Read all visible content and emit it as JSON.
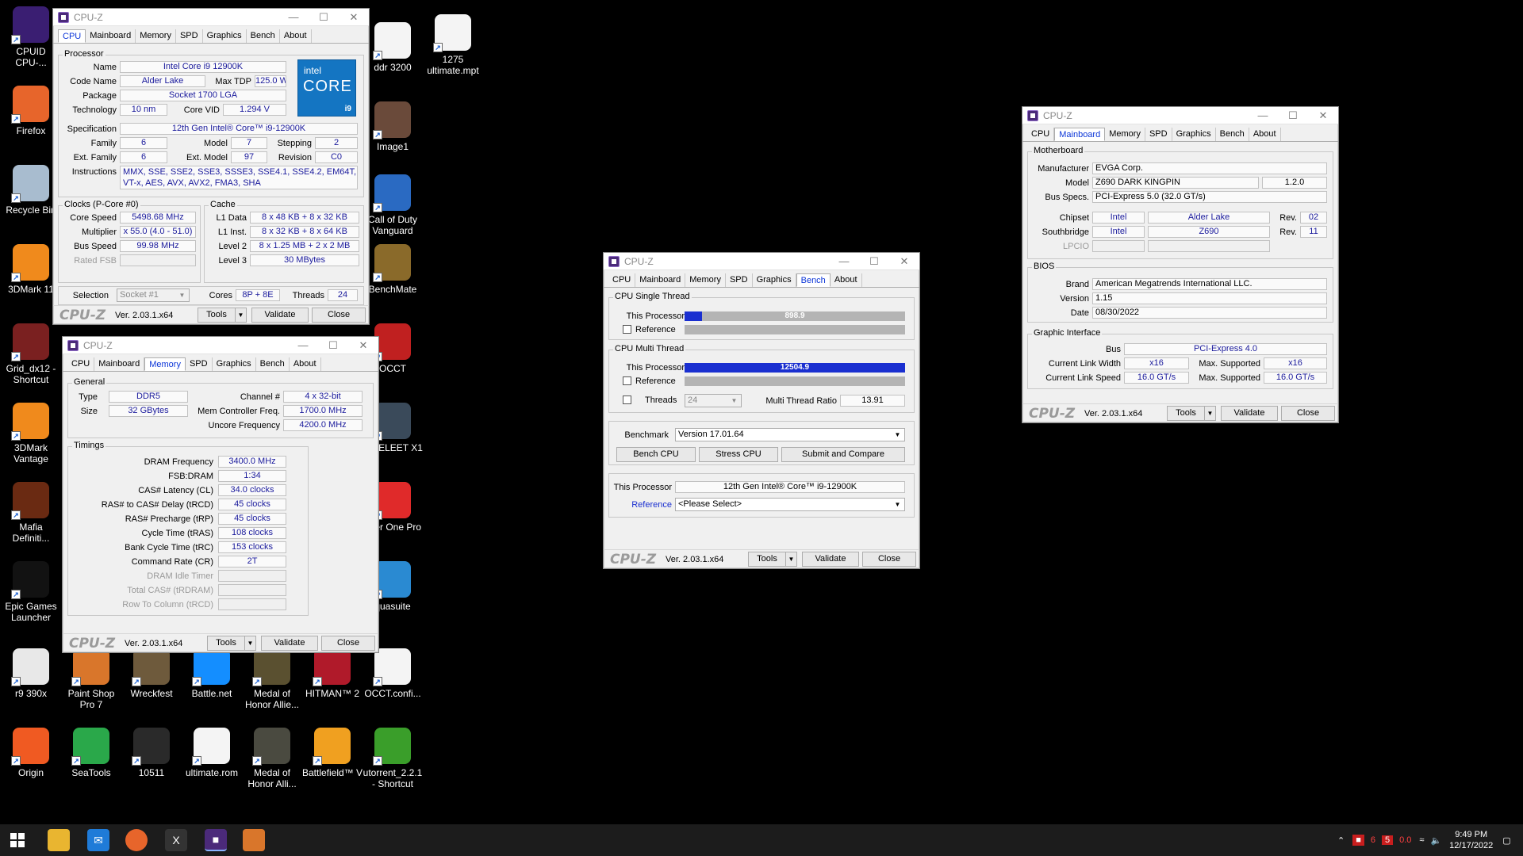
{
  "desktop": {
    "icons": [
      {
        "label": "CPUID CPU-...",
        "icon": "cpuz-icon",
        "color": "#3a1e72"
      },
      {
        "label": "Firefox",
        "icon": "firefox-icon",
        "color": "#e7652b"
      },
      {
        "label": "Recycle Bin",
        "icon": "recycle-bin-icon",
        "color": "#a8bccf"
      },
      {
        "label": "3DMark 11",
        "icon": "3dmark-icon",
        "color": "#f08a1c"
      },
      {
        "label": "Grid_dx12 - Shortcut",
        "icon": "grid-game-icon",
        "color": "#7a2020"
      },
      {
        "label": "3DMark Vantage",
        "icon": "3dmark-vantage-icon",
        "color": "#f08a1c"
      },
      {
        "label": "Mafia Definiti...",
        "icon": "mafia-icon",
        "color": "#6a2a12"
      },
      {
        "label": "Epic Games Launcher",
        "icon": "epic-games-icon",
        "color": "#121212"
      },
      {
        "label": "r9 390x",
        "icon": "file-icon",
        "color": "#e8e8e8"
      },
      {
        "label": "Paint Shop Pro 7",
        "icon": "paint-shop-icon",
        "color": "#d9762b"
      },
      {
        "label": "Wreckfest",
        "icon": "wreckfest-icon",
        "color": "#6e5a3c"
      },
      {
        "label": "Battle.net",
        "icon": "battlenet-icon",
        "color": "#148eff"
      },
      {
        "label": "Medal of Honor Allie...",
        "icon": "medal-of-honor-icon",
        "color": "#5a5030"
      },
      {
        "label": "HITMAN™ 2",
        "icon": "hitman-icon",
        "color": "#b01a2a"
      },
      {
        "label": "OCCT.confi...",
        "icon": "document-icon",
        "color": "#f4f4f4"
      },
      {
        "label": "Origin",
        "icon": "origin-icon",
        "color": "#f05a22"
      },
      {
        "label": "SeaTools",
        "icon": "seatools-icon",
        "color": "#2aa84a"
      },
      {
        "label": "10511",
        "icon": "image-icon",
        "color": "#2a2a2a"
      },
      {
        "label": "ultimate.rom",
        "icon": "document-icon",
        "color": "#f4f4f4"
      },
      {
        "label": "Medal of Honor Alli...",
        "icon": "medal-of-honor-icon",
        "color": "#4a4a40"
      },
      {
        "label": "Battlefield™ V",
        "icon": "battlefield-icon",
        "color": "#f0a020"
      },
      {
        "label": "utorrent_2.2.1 - Shortcut",
        "icon": "utorrent-icon",
        "color": "#3a9e2a"
      },
      {
        "label": "ddr 3200",
        "icon": "document-icon",
        "color": "#f4f4f4"
      },
      {
        "label": "1275 ultimate.mpt",
        "icon": "document-icon",
        "color": "#f4f4f4"
      },
      {
        "label": "Image1",
        "icon": "image-icon",
        "color": "#6a4a3a"
      },
      {
        "label": "Call of Duty Vanguard",
        "icon": "call-of-duty-icon",
        "color": "#2a6ac2"
      },
      {
        "label": "BenchMate",
        "icon": "benchmate-icon",
        "color": "#8a6a2a"
      },
      {
        "label": "OCCT",
        "icon": "occt-icon",
        "color": "#c02020"
      },
      {
        "label": "GA ELEET X1",
        "icon": "eleet-icon",
        "color": "#3a4a5a"
      },
      {
        "label": "aner One Pro",
        "icon": "cleaner-icon",
        "color": "#e02a2a"
      },
      {
        "label": "quasuite",
        "icon": "aquasuite-icon",
        "color": "#2a8ad2"
      }
    ]
  },
  "common": {
    "window_title": "CPU-Z",
    "tabs": [
      "CPU",
      "Mainboard",
      "Memory",
      "SPD",
      "Graphics",
      "Bench",
      "About"
    ],
    "logo": "CPU-Z",
    "version": "Ver. 2.03.1.x64",
    "tools": "Tools",
    "validate": "Validate",
    "close": "Close"
  },
  "cpu_tab": {
    "processor_group": "Processor",
    "name_label": "Name",
    "name": "Intel Core i9 12900K",
    "codename_label": "Code Name",
    "codename": "Alder Lake",
    "maxtdp_label": "Max TDP",
    "maxtdp": "125.0 W",
    "package_label": "Package",
    "package": "Socket 1700 LGA",
    "technology_label": "Technology",
    "technology": "10 nm",
    "corevid_label": "Core VID",
    "corevid": "1.294 V",
    "spec_label": "Specification",
    "spec": "12th Gen Intel® Core™ i9-12900K",
    "family_label": "Family",
    "family": "6",
    "model_label": "Model",
    "model": "7",
    "stepping_label": "Stepping",
    "stepping": "2",
    "extfamily_label": "Ext. Family",
    "extfamily": "6",
    "extmodel_label": "Ext. Model",
    "extmodel": "97",
    "revision_label": "Revision",
    "revision": "C0",
    "instructions_label": "Instructions",
    "instructions": "MMX, SSE, SSE2, SSE3, SSSE3, SSE4.1, SSE4.2, EM64T, VT-x, AES, AVX, AVX2, FMA3, SHA",
    "clocks_group": "Clocks (P-Core #0)",
    "corespeed_label": "Core Speed",
    "corespeed": "5498.68 MHz",
    "multiplier_label": "Multiplier",
    "multiplier": "x 55.0 (4.0 - 51.0)",
    "busspeed_label": "Bus Speed",
    "busspeed": "99.98 MHz",
    "ratedfsb_label": "Rated FSB",
    "cache_group": "Cache",
    "l1data_label": "L1 Data",
    "l1data": "8 x 48 KB + 8 x 32 KB",
    "l1inst_label": "L1 Inst.",
    "l1inst": "8 x 32 KB + 8 x 64 KB",
    "l2_label": "Level 2",
    "l2": "8 x 1.25 MB + 2 x 2 MB",
    "l3_label": "Level 3",
    "l3": "30 MBytes",
    "selection_label": "Selection",
    "selection": "Socket #1",
    "cores_label": "Cores",
    "cores": "8P + 8E",
    "threads_label": "Threads",
    "threads": "24",
    "intel_logo": {
      "brand": "intel",
      "line": "CORE",
      "tier": "i9"
    }
  },
  "memory_tab": {
    "general_group": "General",
    "type_label": "Type",
    "type": "DDR5",
    "size_label": "Size",
    "size": "32 GBytes",
    "channel_label": "Channel #",
    "channel": "4 x 32-bit",
    "memctrl_label": "Mem Controller Freq.",
    "memctrl": "1700.0 MHz",
    "uncore_label": "Uncore Frequency",
    "uncore": "4200.0 MHz",
    "timings_group": "Timings",
    "timings": [
      {
        "label": "DRAM Frequency",
        "value": "3400.0 MHz"
      },
      {
        "label": "FSB:DRAM",
        "value": "1:34"
      },
      {
        "label": "CAS# Latency (CL)",
        "value": "34.0 clocks"
      },
      {
        "label": "RAS# to CAS# Delay (tRCD)",
        "value": "45 clocks"
      },
      {
        "label": "RAS# Precharge (tRP)",
        "value": "45 clocks"
      },
      {
        "label": "Cycle Time (tRAS)",
        "value": "108 clocks"
      },
      {
        "label": "Bank Cycle Time (tRC)",
        "value": "153 clocks"
      },
      {
        "label": "Command Rate (CR)",
        "value": "2T"
      }
    ],
    "disabled_timings": [
      "DRAM Idle Timer",
      "Total CAS# (tRDRAM)",
      "Row To Column (tRCD)"
    ]
  },
  "bench_tab": {
    "single_group": "CPU Single Thread",
    "multi_group": "CPU Multi Thread",
    "this_processor_label": "This Processor",
    "reference_label": "Reference",
    "single_score": "898.9",
    "single_fraction": 0.08,
    "multi_score": "12504.9",
    "multi_fraction": 1.0,
    "threads_label": "Threads",
    "threads": "24",
    "ratio_label": "Multi Thread Ratio",
    "ratio": "13.91",
    "benchmark_label": "Benchmark",
    "benchmark": "Version 17.01.64",
    "bench_cpu": "Bench CPU",
    "stress_cpu": "Stress CPU",
    "submit": "Submit and Compare",
    "this_processor_name": "12th Gen Intel® Core™ i9-12900K",
    "reference_link": "Reference",
    "reference_select": "<Please Select>"
  },
  "mainboard_tab": {
    "motherboard_group": "Motherboard",
    "manufacturer_label": "Manufacturer",
    "manufacturer": "EVGA Corp.",
    "model_label": "Model",
    "model": "Z690 DARK KINGPIN",
    "model_rev": "1.2.0",
    "busspecs_label": "Bus Specs.",
    "busspecs": "PCI-Express 5.0 (32.0 GT/s)",
    "chipset_label": "Chipset",
    "chipset_vendor": "Intel",
    "chipset_name": "Alder Lake",
    "rev_label": "Rev.",
    "chipset_rev": "02",
    "southbridge_label": "Southbridge",
    "sb_vendor": "Intel",
    "sb_name": "Z690",
    "sb_rev": "11",
    "lpcio_label": "LPCIO",
    "bios_group": "BIOS",
    "brand_label": "Brand",
    "brand": "American Megatrends International LLC.",
    "version_label": "Version",
    "version": "1.15",
    "date_label": "Date",
    "date": "08/30/2022",
    "graphic_group": "Graphic Interface",
    "bus_label": "Bus",
    "bus": "PCI-Express 4.0",
    "linkwidth_label": "Current Link Width",
    "linkwidth": "x16",
    "maxsup_label": "Max. Supported",
    "maxwidth": "x16",
    "linkspeed_label": "Current Link Speed",
    "linkspeed": "16.0 GT/s",
    "maxspeed": "16.0 GT/s"
  },
  "taskbar": {
    "time": "9:49 PM",
    "date": "12/17/2022",
    "tray_values": [
      "6",
      "5",
      "0.0"
    ],
    "colors": {
      "accent": "#1a2fd0",
      "tab_active": "#0b35d8",
      "value_text": "#1a1a9c"
    }
  }
}
